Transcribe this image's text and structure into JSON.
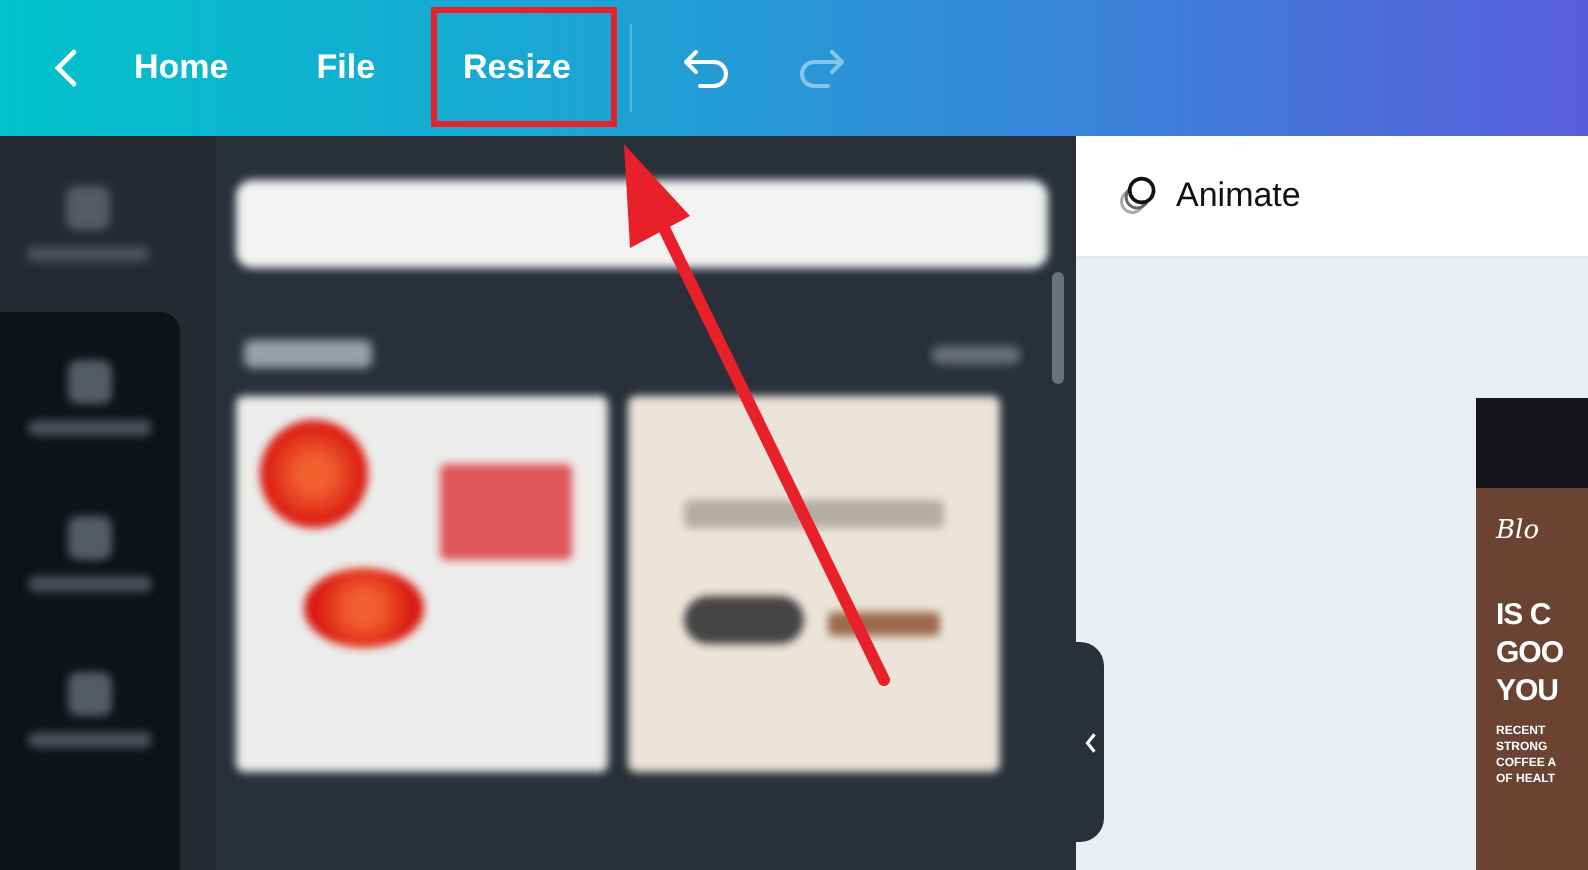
{
  "topbar": {
    "nav": [
      {
        "label": "Home"
      },
      {
        "label": "File"
      },
      {
        "label": "Resize"
      }
    ],
    "undo": {
      "disabled": false
    },
    "redo": {
      "disabled": true
    }
  },
  "toolbar": {
    "animate": "Animate"
  },
  "design": {
    "script": "Blo",
    "heading": [
      "IS C",
      "GOO",
      "YOU"
    ],
    "body": [
      "RECENT",
      "STRONG",
      "COFFEE A",
      "OF HEALT"
    ]
  }
}
